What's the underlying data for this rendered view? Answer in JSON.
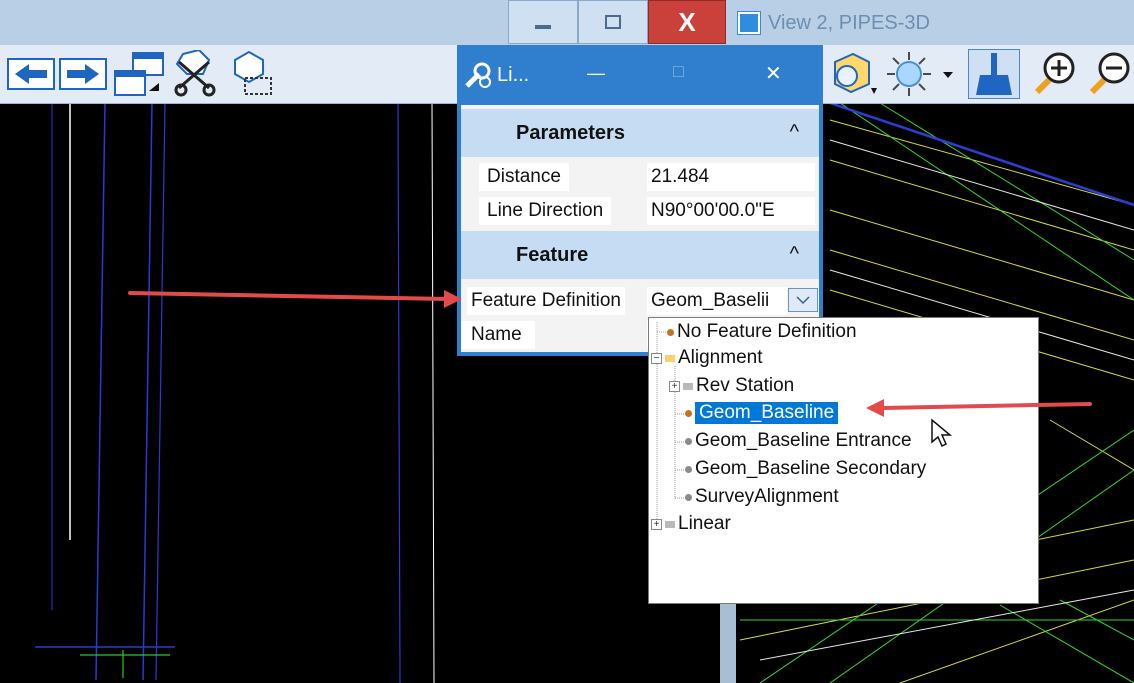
{
  "window": {
    "title": "View 2, PIPES-3D",
    "min_label": "—",
    "max_label": "□",
    "close_label": "X"
  },
  "toolbar": {
    "icons": [
      "arrow-left-icon",
      "arrow-right-icon",
      "window-arrange-icon",
      "cut-icon",
      "copy-element-icon",
      "view-shape-icon",
      "light-icon",
      "brush-icon",
      "zoom-in-icon",
      "zoom-out-icon"
    ]
  },
  "dialog": {
    "title": "Li...",
    "min_label": "—",
    "max_label": "□",
    "close_label": "✕",
    "parameters": {
      "header": "Parameters",
      "chevron": "^",
      "rows": [
        {
          "label": "Distance",
          "value": "21.484"
        },
        {
          "label": "Line Direction",
          "value": "N90°00'00.0\"E"
        }
      ]
    },
    "feature": {
      "header": "Feature",
      "chevron": "^",
      "definition_label": "Feature Definition",
      "definition_value": "Geom_Baselii",
      "name_label": "Name",
      "name_value": ""
    }
  },
  "dropdown": {
    "items": [
      {
        "label": "No Feature Definition",
        "level": 0
      },
      {
        "label": "Alignment",
        "level": 0,
        "expander": "−"
      },
      {
        "label": "Rev Station",
        "level": 1,
        "expander": "+"
      },
      {
        "label": "Geom_Baseline",
        "level": 1,
        "selected": true
      },
      {
        "label": "Geom_Baseline Entrance",
        "level": 1
      },
      {
        "label": "Geom_Baseline Secondary",
        "level": 1
      },
      {
        "label": "SurveyAlignment",
        "level": 1
      },
      {
        "label": "Linear",
        "level": 0,
        "expander": "+"
      }
    ]
  },
  "colors": {
    "dialog_title": "#2f7fce",
    "section_header": "#c6dcf3",
    "selection": "#0078d7",
    "annotation_arrow": "#e34b4b"
  }
}
